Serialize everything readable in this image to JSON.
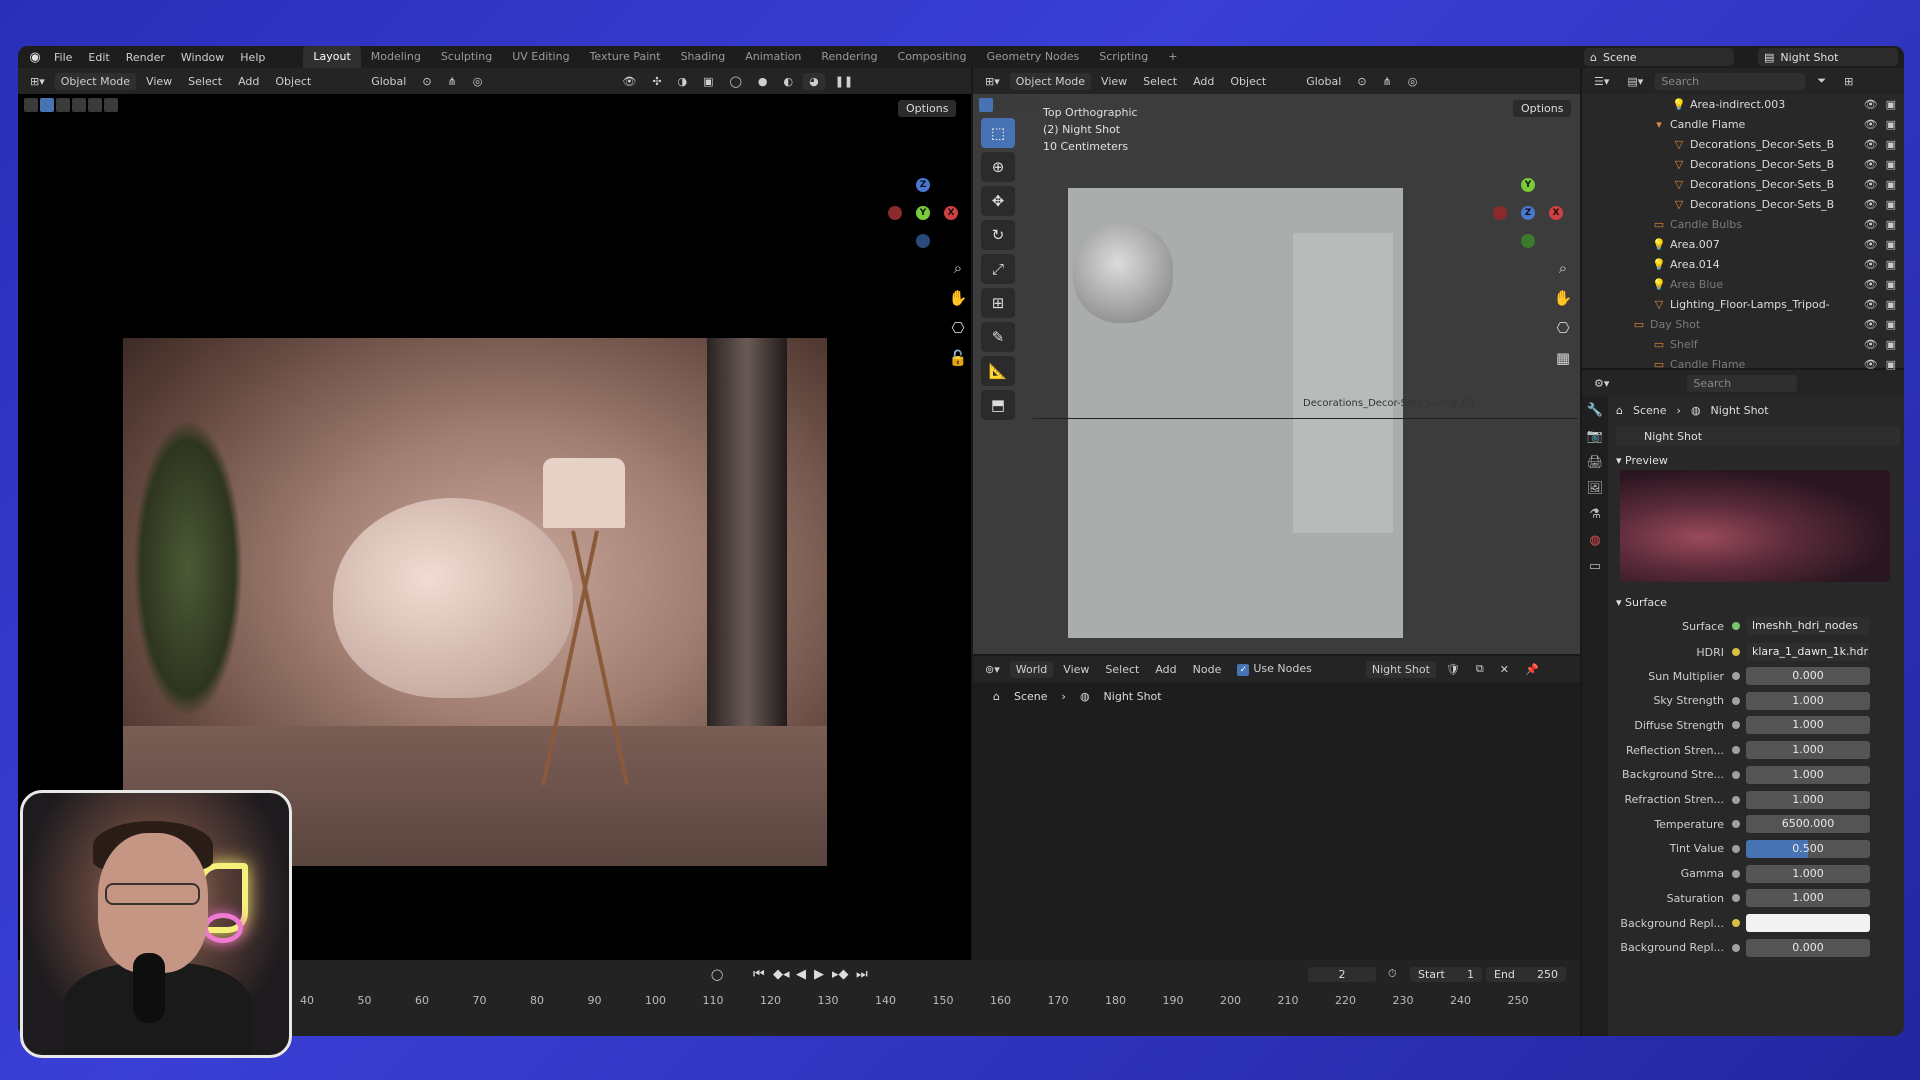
{
  "menu": [
    "File",
    "Edit",
    "Render",
    "Window",
    "Help"
  ],
  "workspaces": [
    "Layout",
    "Modeling",
    "Sculpting",
    "UV Editing",
    "Texture Paint",
    "Shading",
    "Animation",
    "Rendering",
    "Compositing",
    "Geometry Nodes",
    "Scripting"
  ],
  "active_workspace": "Layout",
  "top_right": {
    "scene": "Scene",
    "view_layer": "Night Shot"
  },
  "left_viewport": {
    "mode": "Object Mode",
    "menus": [
      "View",
      "Select",
      "Add",
      "Object"
    ],
    "transform": "Global",
    "options": "Options"
  },
  "right_viewport": {
    "mode": "Object Mode",
    "menus": [
      "View",
      "Select",
      "Add",
      "Object"
    ],
    "transform": "Global",
    "options": "Options",
    "overlay_lines": [
      "Top Orthographic",
      "(2) Night Shot",
      "10 Centimeters"
    ],
    "object_label": "Decorations_Decor-Sets_Living_09"
  },
  "node_editor": {
    "type": "World",
    "menus": [
      "View",
      "Select",
      "Add",
      "Node"
    ],
    "use_nodes": "Use Nodes",
    "world": "Night Shot",
    "breadcrumb": [
      "Scene",
      "Night Shot"
    ]
  },
  "timeline": {
    "current_frame": "2",
    "start_label": "Start",
    "start": "1",
    "end_label": "End",
    "end": "250",
    "ticks": [
      "40",
      "50",
      "60",
      "70",
      "80",
      "90",
      "100",
      "110",
      "120",
      "130",
      "140",
      "150",
      "160",
      "170",
      "180",
      "190",
      "200",
      "210",
      "220",
      "230",
      "240",
      "250"
    ]
  },
  "outliner": {
    "search_placeholder": "Search",
    "rows": [
      {
        "label": "Area-indirect.003",
        "dim": false
      },
      {
        "label": "Candle Flame",
        "dim": false
      },
      {
        "label": "Decorations_Decor-Sets_B",
        "dim": false
      },
      {
        "label": "Decorations_Decor-Sets_B",
        "dim": false
      },
      {
        "label": "Decorations_Decor-Sets_B",
        "dim": false
      },
      {
        "label": "Decorations_Decor-Sets_B",
        "dim": false
      },
      {
        "label": "Candle Bulbs",
        "dim": true
      },
      {
        "label": "Area.007",
        "dim": false
      },
      {
        "label": "Area.014",
        "dim": false
      },
      {
        "label": "Area Blue",
        "dim": true
      },
      {
        "label": "Lighting_Floor-Lamps_Tripod-",
        "dim": false
      },
      {
        "label": "Day Shot",
        "dim": true
      },
      {
        "label": "Shelf",
        "dim": true
      },
      {
        "label": "Candle Flame",
        "dim": true
      }
    ]
  },
  "properties": {
    "search_placeholder": "Search",
    "breadcrumb": [
      "Scene",
      "Night Shot"
    ],
    "world_name": "Night Shot",
    "preview_label": "Preview",
    "surface_label": "Surface",
    "surface": {
      "label": "Surface",
      "value": "lmeshh_hdri_nodes"
    },
    "hdri": {
      "label": "HDRI",
      "value": "klara_1_dawn_1k.hdr"
    },
    "fields": [
      {
        "label": "Sun Multiplier",
        "value": "0.000"
      },
      {
        "label": "Sky Strength",
        "value": "1.000"
      },
      {
        "label": "Diffuse Strength",
        "value": "1.000"
      },
      {
        "label": "Reflection Stren...",
        "value": "1.000"
      },
      {
        "label": "Background Stre...",
        "value": "1.000"
      },
      {
        "label": "Refraction Stren...",
        "value": "1.000"
      },
      {
        "label": "Temperature",
        "value": "6500.000"
      },
      {
        "label": "Tint Value",
        "value": "0.500"
      },
      {
        "label": "Gamma",
        "value": "1.000"
      },
      {
        "label": "Saturation",
        "value": "1.000"
      },
      {
        "label": "Background Repl...",
        "value": ""
      },
      {
        "label": "Background Repl...",
        "value": "0.000"
      }
    ]
  },
  "colors": {
    "accent": "#4772b3",
    "background_gradient": "#3a3fd6"
  }
}
